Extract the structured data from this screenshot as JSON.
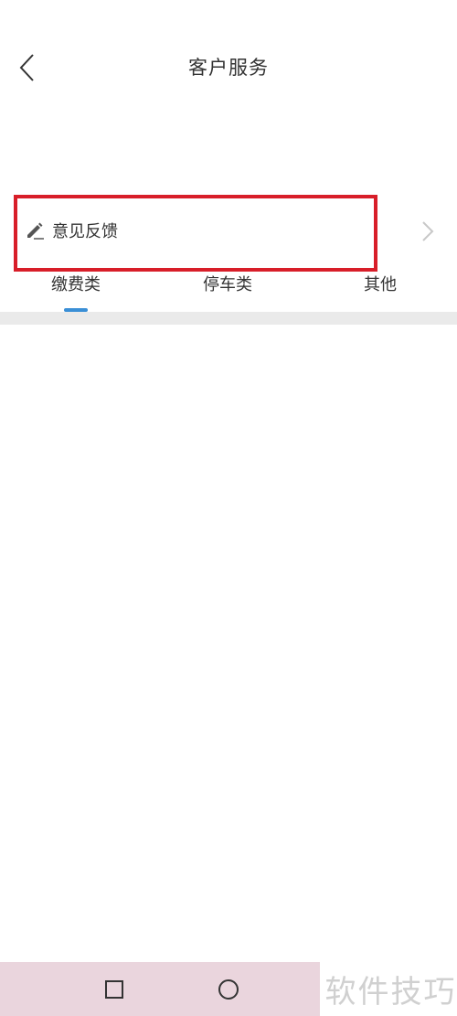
{
  "header": {
    "title": "客户服务"
  },
  "feedback": {
    "label": "意见反馈"
  },
  "tabs": [
    {
      "label": "缴费类",
      "active": true
    },
    {
      "label": "停车类",
      "active": false
    },
    {
      "label": "其他",
      "active": false
    }
  ],
  "colors": {
    "highlight_border": "#d81e29",
    "active_tab_indicator": "#3a8fd6",
    "divider": "#eaeaea",
    "nav_bar": "#ead5dd"
  },
  "icons": {
    "back": "chevron-left-icon",
    "feedback": "pencil-icon",
    "row_arrow": "chevron-right-icon",
    "nav_recent": "square-icon",
    "nav_home": "circle-icon"
  },
  "watermark": {
    "text": "软件技巧"
  }
}
